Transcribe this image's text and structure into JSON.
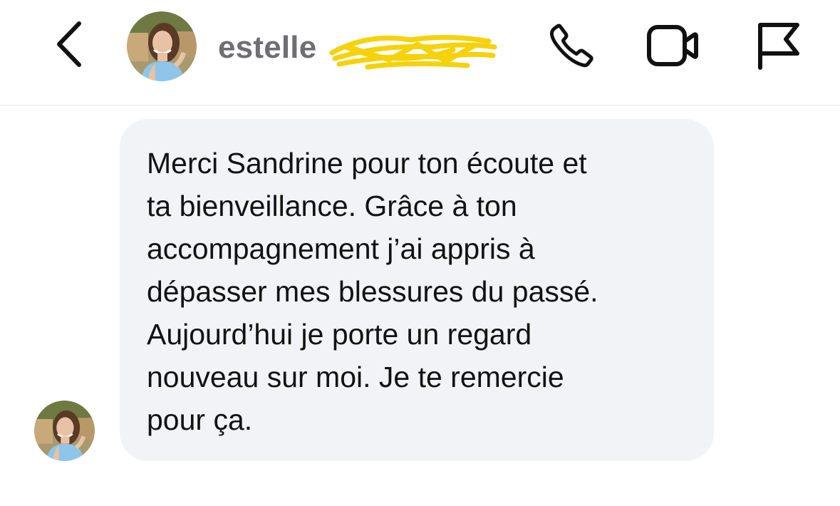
{
  "header": {
    "username": "estelle",
    "back_icon": "chevron-left-icon",
    "call_icon": "phone-icon",
    "video_icon": "video-camera-icon",
    "report_icon": "flag-icon",
    "redaction_color": "#f5d20a"
  },
  "message": {
    "lines": [
      "Merci Sandrine pour ton écoute et",
      "ta bienveillance. Grâce à ton",
      "accompagnement j’ai appris à",
      "dépasser mes blessures du passé.",
      "Aujourd’hui je porte un regard",
      "nouveau sur moi. Je te remercie",
      "pour ça."
    ],
    "bubble_color": "#f1f3f6"
  }
}
